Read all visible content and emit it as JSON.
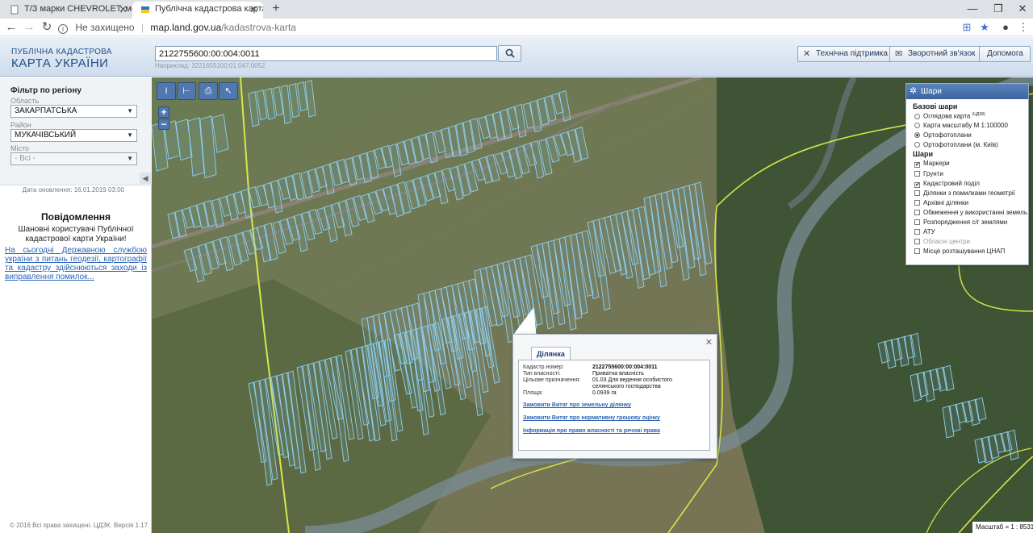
{
  "browser": {
    "tabs": [
      {
        "title": "Т/З марки CHEVROLET, модель"
      },
      {
        "title": "Публічна кадастрова карта Укр"
      }
    ],
    "new_tab": "+",
    "url_secure": "Не захищено",
    "url_host": "map.land.gov.ua",
    "url_path": "/kadastrova-karta"
  },
  "header": {
    "logo_line1": "ПУБЛІЧНА КАДАСТРОВА",
    "logo_line2": "КАРТА УКРАЇНИ",
    "search_value": "2122755600:00:004:0011",
    "search_hint": "Наприклад: 3221655100:01:047:0052",
    "support_label": "Технічна підтримка",
    "feedback_label": "Зворотний зв'язок",
    "help_label": "Допомога"
  },
  "filter": {
    "title": "Фільтр по регіону",
    "oblast_label": "Область",
    "oblast_value": "ЗАКАРПАТСЬКА",
    "rayon_label": "Район",
    "rayon_value": "МУКАЧІВСЬКИЙ",
    "city_label": "Місто",
    "city_value": "- Всі -",
    "updated": "Дата оновлення: 16.01.2019 03:00"
  },
  "notice": {
    "title": "Повідомлення",
    "text": "Шановні користувачі Публічної кадастрової карти України!",
    "link": "На сьогодні Державною службою україни з питань геодезії, картографії та кадастру здійснюються заходи із виправлення помилок..."
  },
  "copyright": "© 2016 Всі права захищені. ЦДЗК. Версія 1.17.",
  "layers": {
    "title": "Шари",
    "base_title": "Базові шари",
    "base": [
      {
        "label": "Оглядова карта",
        "sup": "(ЦДЗК)",
        "checked": false
      },
      {
        "label": "Карта масштабу М 1:100000",
        "checked": false
      },
      {
        "label": "Ортофотоплани",
        "checked": true
      },
      {
        "label": "Ортофотоплани (м. Київ)",
        "checked": false
      }
    ],
    "overlay_title": "Шари",
    "overlays": [
      {
        "label": "Маркери",
        "checked": true
      },
      {
        "label": "Грунти",
        "checked": false
      },
      {
        "label": "Кадастровий поділ",
        "checked": true
      },
      {
        "label": "Ділянки з помилками геометрії",
        "checked": false
      },
      {
        "label": "Архівні ділянки",
        "checked": false
      },
      {
        "label": "Обмеження у використанні земель",
        "checked": false
      },
      {
        "label": "Розпорядження с/г землями",
        "checked": false
      },
      {
        "label": "АТУ",
        "checked": false
      },
      {
        "label": "Обласні центри",
        "checked": false
      },
      {
        "label": "Місце розташування ЦНАП",
        "checked": false
      }
    ]
  },
  "popup": {
    "tab": "Ділянка",
    "cad_label": "Кадастр.номер:",
    "cad_value": "2122755600:00:004:0011",
    "own_label": "Тип власності:",
    "own_value": "Приватна власність",
    "purpose_label": "Цільове призначення:",
    "purpose_value": "01.03 Для ведення особистого селянського господарства",
    "area_label": "Площа:",
    "area_value": "0.0939 га",
    "link1": "Замовити Витяг про земельну ділянку",
    "link2": "Замовити Витяг про нормативну грошову оцінку",
    "link3": "Інформація про право власності та речові права"
  },
  "scale": "Масштаб = 1 : 8531",
  "colors": {
    "map_lines": "#8fd0f2",
    "boundary": "#d6e84a",
    "accent": "#3c659f"
  }
}
